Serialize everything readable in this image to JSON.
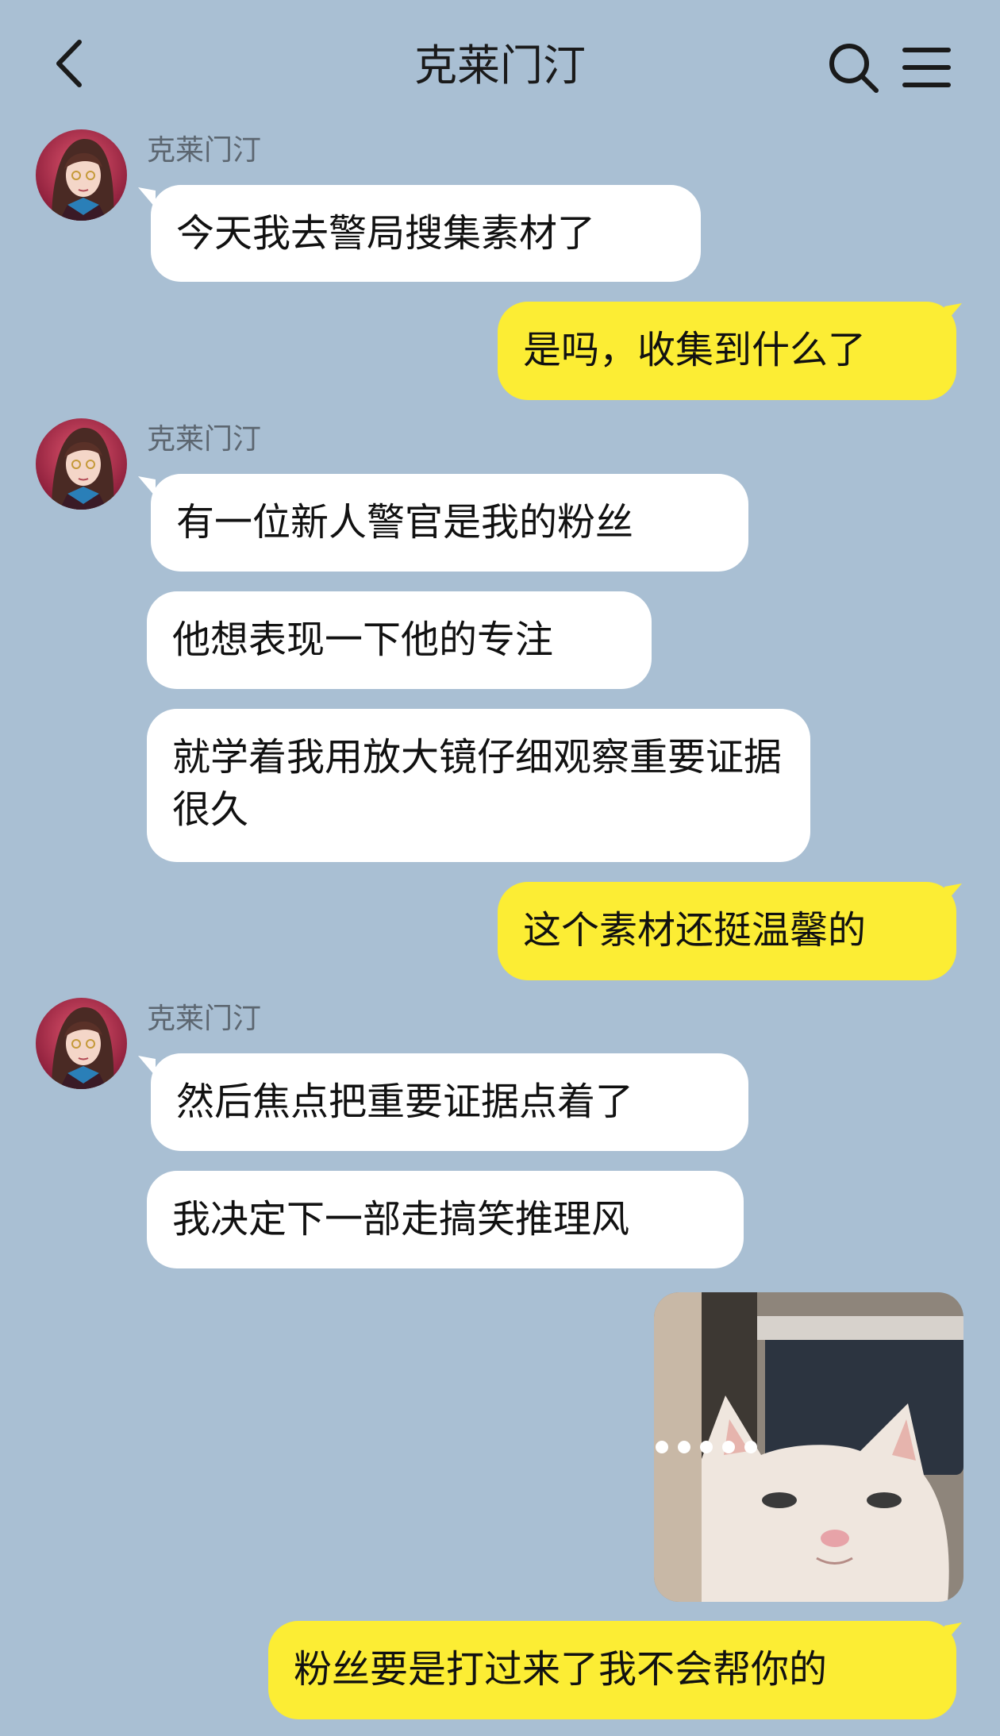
{
  "header": {
    "title": "克莱门汀",
    "back_icon": "chevron-left-icon",
    "search_icon": "search-icon",
    "menu_icon": "menu-icon"
  },
  "colors": {
    "background": "#a9bfd3",
    "incoming_bubble": "#ffffff",
    "outgoing_bubble": "#fced34"
  },
  "messages": [
    {
      "sender": "克莱门汀",
      "text": "今天我去警局搜集素材了"
    },
    {
      "sender": "me",
      "text": "是吗，收集到什么了"
    },
    {
      "sender": "克莱门汀",
      "text": "有一位新人警官是我的粉丝"
    },
    {
      "sender": "克莱门汀",
      "text": "他想表现一下他的专注"
    },
    {
      "sender": "克莱门汀",
      "text": "就学着我用放大镜仔细观察重要证据很久"
    },
    {
      "sender": "me",
      "text": "这个素材还挺温馨的"
    },
    {
      "sender": "克莱门汀",
      "text": "然后焦点把重要证据点着了"
    },
    {
      "sender": "克莱门汀",
      "text": "我决定下一部走搞笑推理风"
    },
    {
      "sender": "me",
      "sticker": "cat-sticker-image"
    },
    {
      "sender": "me",
      "text": "粉丝要是打过来了我不会帮你的"
    }
  ]
}
